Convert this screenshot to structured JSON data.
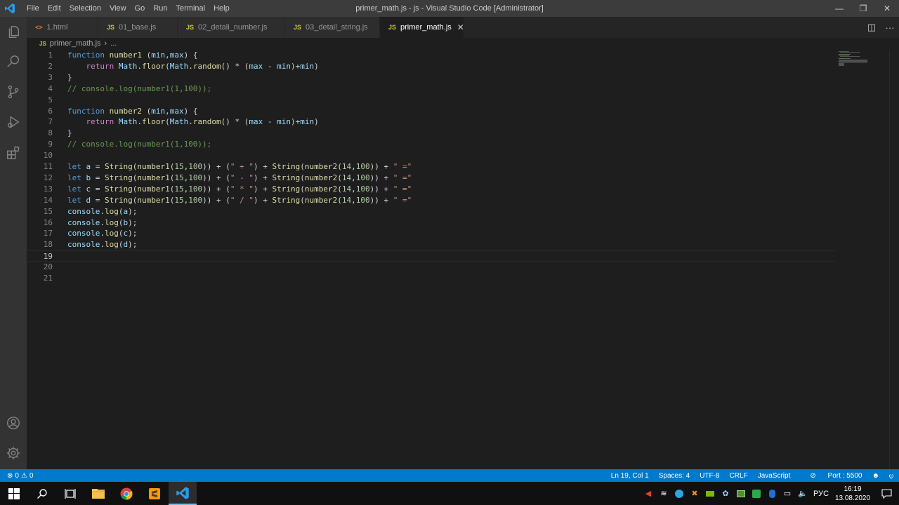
{
  "window": {
    "title": "primer_math.js - js - Visual Studio Code [Administrator]",
    "menu": [
      "File",
      "Edit",
      "Selection",
      "View",
      "Go",
      "Run",
      "Terminal",
      "Help"
    ]
  },
  "tabs": [
    {
      "label": "1.html",
      "type": "html",
      "active": false
    },
    {
      "label": "01_base.js",
      "type": "js",
      "active": false
    },
    {
      "label": "02_detali_number.js",
      "type": "js",
      "active": false
    },
    {
      "label": "03_detail_string.js",
      "type": "js",
      "active": false
    },
    {
      "label": "primer_math.js",
      "type": "js",
      "active": true
    }
  ],
  "breadcrumb": {
    "file": "primer_math.js",
    "rest": "..."
  },
  "editor": {
    "current_line": 19,
    "lines": [
      "function number1 (min,max) {",
      "    return Math.floor(Math.random() * (max - min)+min)",
      "}",
      "// console.log(number1(1,100));",
      "",
      "function number2 (min,max) {",
      "    return Math.floor(Math.random() * (max - min)+min)",
      "}",
      "// console.log(number1(1,100));",
      "",
      "let a = String(number1(15,100)) + (\" + \") + String(number2(14,100)) + \" =\"",
      "let b = String(number1(15,100)) + (\" - \") + String(number2(14,100)) + \" =\"",
      "let c = String(number1(15,100)) + (\" * \") + String(number2(14,100)) + \" =\"",
      "let d = String(number1(15,100)) + (\" / \") + String(number2(14,100)) + \" =\"",
      "console.log(a);",
      "console.log(b);",
      "console.log(c);",
      "console.log(d);",
      "",
      "",
      ""
    ]
  },
  "statusbar": {
    "errors": "0",
    "warnings": "0",
    "position": "Ln 19, Col 1",
    "spaces": "Spaces: 4",
    "encoding": "UTF-8",
    "eol": "CRLF",
    "language": "JavaScript",
    "port": "Port : 5500"
  },
  "taskbar": {
    "lang": "РУС",
    "time": "16:19",
    "date": "13.08.2020"
  },
  "colors": {
    "accent": "#007acc",
    "titlebar": "#3c3c3c",
    "activitybar": "#333333",
    "editor_bg": "#1e1e1e"
  }
}
